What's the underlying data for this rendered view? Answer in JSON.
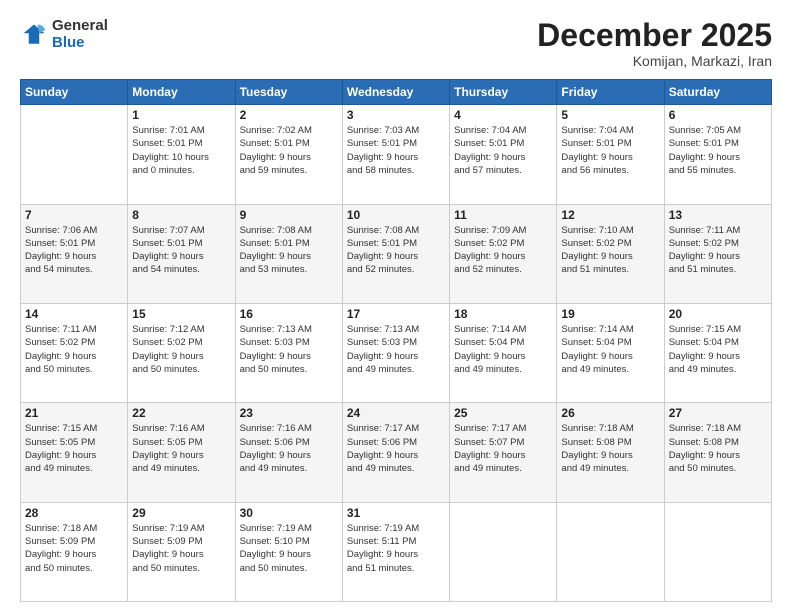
{
  "logo": {
    "general": "General",
    "blue": "Blue"
  },
  "header": {
    "month": "December 2025",
    "location": "Komijan, Markazi, Iran"
  },
  "days_of_week": [
    "Sunday",
    "Monday",
    "Tuesday",
    "Wednesday",
    "Thursday",
    "Friday",
    "Saturday"
  ],
  "weeks": [
    [
      {
        "day": "",
        "info": ""
      },
      {
        "day": "1",
        "info": "Sunrise: 7:01 AM\nSunset: 5:01 PM\nDaylight: 10 hours\nand 0 minutes."
      },
      {
        "day": "2",
        "info": "Sunrise: 7:02 AM\nSunset: 5:01 PM\nDaylight: 9 hours\nand 59 minutes."
      },
      {
        "day": "3",
        "info": "Sunrise: 7:03 AM\nSunset: 5:01 PM\nDaylight: 9 hours\nand 58 minutes."
      },
      {
        "day": "4",
        "info": "Sunrise: 7:04 AM\nSunset: 5:01 PM\nDaylight: 9 hours\nand 57 minutes."
      },
      {
        "day": "5",
        "info": "Sunrise: 7:04 AM\nSunset: 5:01 PM\nDaylight: 9 hours\nand 56 minutes."
      },
      {
        "day": "6",
        "info": "Sunrise: 7:05 AM\nSunset: 5:01 PM\nDaylight: 9 hours\nand 55 minutes."
      }
    ],
    [
      {
        "day": "7",
        "info": "Sunrise: 7:06 AM\nSunset: 5:01 PM\nDaylight: 9 hours\nand 54 minutes."
      },
      {
        "day": "8",
        "info": "Sunrise: 7:07 AM\nSunset: 5:01 PM\nDaylight: 9 hours\nand 54 minutes."
      },
      {
        "day": "9",
        "info": "Sunrise: 7:08 AM\nSunset: 5:01 PM\nDaylight: 9 hours\nand 53 minutes."
      },
      {
        "day": "10",
        "info": "Sunrise: 7:08 AM\nSunset: 5:01 PM\nDaylight: 9 hours\nand 52 minutes."
      },
      {
        "day": "11",
        "info": "Sunrise: 7:09 AM\nSunset: 5:02 PM\nDaylight: 9 hours\nand 52 minutes."
      },
      {
        "day": "12",
        "info": "Sunrise: 7:10 AM\nSunset: 5:02 PM\nDaylight: 9 hours\nand 51 minutes."
      },
      {
        "day": "13",
        "info": "Sunrise: 7:11 AM\nSunset: 5:02 PM\nDaylight: 9 hours\nand 51 minutes."
      }
    ],
    [
      {
        "day": "14",
        "info": "Sunrise: 7:11 AM\nSunset: 5:02 PM\nDaylight: 9 hours\nand 50 minutes."
      },
      {
        "day": "15",
        "info": "Sunrise: 7:12 AM\nSunset: 5:02 PM\nDaylight: 9 hours\nand 50 minutes."
      },
      {
        "day": "16",
        "info": "Sunrise: 7:13 AM\nSunset: 5:03 PM\nDaylight: 9 hours\nand 50 minutes."
      },
      {
        "day": "17",
        "info": "Sunrise: 7:13 AM\nSunset: 5:03 PM\nDaylight: 9 hours\nand 49 minutes."
      },
      {
        "day": "18",
        "info": "Sunrise: 7:14 AM\nSunset: 5:04 PM\nDaylight: 9 hours\nand 49 minutes."
      },
      {
        "day": "19",
        "info": "Sunrise: 7:14 AM\nSunset: 5:04 PM\nDaylight: 9 hours\nand 49 minutes."
      },
      {
        "day": "20",
        "info": "Sunrise: 7:15 AM\nSunset: 5:04 PM\nDaylight: 9 hours\nand 49 minutes."
      }
    ],
    [
      {
        "day": "21",
        "info": "Sunrise: 7:15 AM\nSunset: 5:05 PM\nDaylight: 9 hours\nand 49 minutes."
      },
      {
        "day": "22",
        "info": "Sunrise: 7:16 AM\nSunset: 5:05 PM\nDaylight: 9 hours\nand 49 minutes."
      },
      {
        "day": "23",
        "info": "Sunrise: 7:16 AM\nSunset: 5:06 PM\nDaylight: 9 hours\nand 49 minutes."
      },
      {
        "day": "24",
        "info": "Sunrise: 7:17 AM\nSunset: 5:06 PM\nDaylight: 9 hours\nand 49 minutes."
      },
      {
        "day": "25",
        "info": "Sunrise: 7:17 AM\nSunset: 5:07 PM\nDaylight: 9 hours\nand 49 minutes."
      },
      {
        "day": "26",
        "info": "Sunrise: 7:18 AM\nSunset: 5:08 PM\nDaylight: 9 hours\nand 49 minutes."
      },
      {
        "day": "27",
        "info": "Sunrise: 7:18 AM\nSunset: 5:08 PM\nDaylight: 9 hours\nand 50 minutes."
      }
    ],
    [
      {
        "day": "28",
        "info": "Sunrise: 7:18 AM\nSunset: 5:09 PM\nDaylight: 9 hours\nand 50 minutes."
      },
      {
        "day": "29",
        "info": "Sunrise: 7:19 AM\nSunset: 5:09 PM\nDaylight: 9 hours\nand 50 minutes."
      },
      {
        "day": "30",
        "info": "Sunrise: 7:19 AM\nSunset: 5:10 PM\nDaylight: 9 hours\nand 50 minutes."
      },
      {
        "day": "31",
        "info": "Sunrise: 7:19 AM\nSunset: 5:11 PM\nDaylight: 9 hours\nand 51 minutes."
      },
      {
        "day": "",
        "info": ""
      },
      {
        "day": "",
        "info": ""
      },
      {
        "day": "",
        "info": ""
      }
    ]
  ]
}
